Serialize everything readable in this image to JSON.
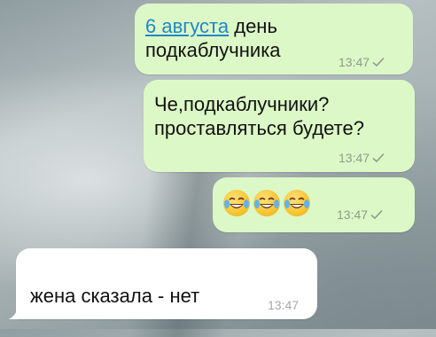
{
  "messages": [
    {
      "direction": "outgoing",
      "link_text": "6 августа",
      "text_after_link": " день",
      "text_line2": "подкаблучника",
      "time": "13:47",
      "status_icon": "single-check-icon"
    },
    {
      "direction": "outgoing",
      "text_line1": "Че,подкаблучники?",
      "text_line2": "проставляться будете?",
      "time": "13:47",
      "status_icon": "single-check-icon"
    },
    {
      "direction": "outgoing",
      "emoji": [
        "face-with-tears-of-joy-icon",
        "face-with-tears-of-joy-icon",
        "face-with-tears-of-joy-icon"
      ],
      "time": "13:47",
      "status_icon": "single-check-icon"
    },
    {
      "direction": "incoming",
      "text": "жена сказала - нет",
      "time": "13:47"
    }
  ],
  "colors": {
    "outgoing_bubble": "#dcf8c6",
    "incoming_bubble": "#ffffff",
    "link": "#1e88c8",
    "timestamp": "#8f9a8c"
  }
}
